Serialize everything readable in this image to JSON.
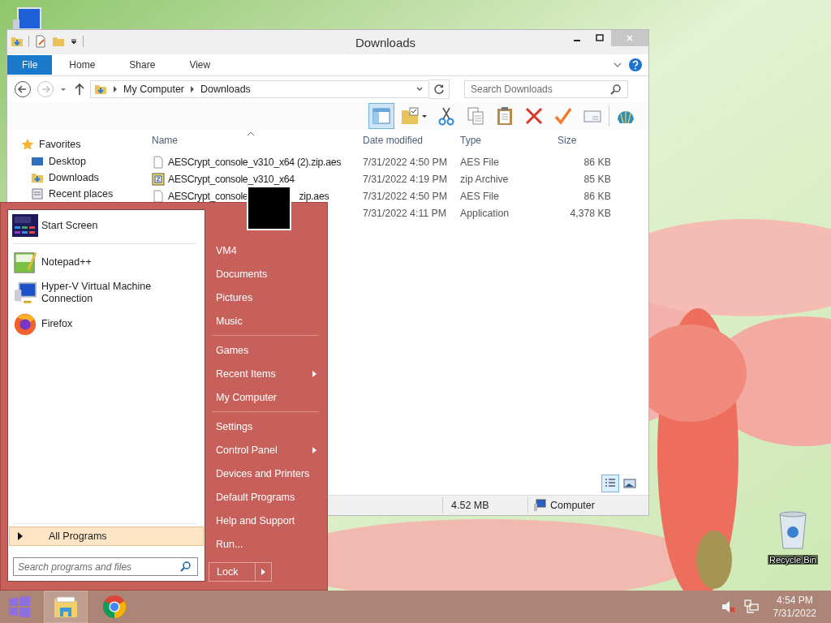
{
  "desktop": {
    "icons": [
      {
        "label": "Recycle Bin",
        "kind": "recycle-bin"
      }
    ]
  },
  "explorer": {
    "title": "Downloads",
    "ribbon_tabs": [
      {
        "label": "File",
        "selected": true
      },
      {
        "label": "Home",
        "selected": false
      },
      {
        "label": "Share",
        "selected": false
      },
      {
        "label": "View",
        "selected": false
      }
    ],
    "navigation": {
      "back": {
        "disabled": false
      },
      "forward": {
        "disabled": true
      }
    },
    "address": {
      "path": [
        "My Computer",
        "Downloads"
      ]
    },
    "search": {
      "placeholder": "Search Downloads"
    },
    "toolbar": [
      {
        "kind": "pane",
        "selected": true
      },
      {
        "kind": "folder-options",
        "selected": false
      },
      {
        "kind": "cut",
        "selected": false
      },
      {
        "kind": "copy",
        "selected": false
      },
      {
        "kind": "paste",
        "selected": false
      },
      {
        "kind": "delete",
        "selected": false
      },
      {
        "kind": "properties",
        "selected": false
      },
      {
        "kind": "email",
        "selected": false
      },
      {
        "kind": "shell",
        "selected": false
      }
    ],
    "sidebar": {
      "items": [
        {
          "label": "Favorites",
          "kind": "favorites"
        },
        {
          "label": "Desktop",
          "kind": "desktop"
        },
        {
          "label": "Downloads",
          "kind": "downloads"
        },
        {
          "label": "Recent places",
          "kind": "recent"
        }
      ]
    },
    "table": {
      "columns": [
        "Name",
        "Date modified",
        "Type",
        "Size"
      ],
      "rows": [
        {
          "kind": "file",
          "name": "AESCrypt_console_v310_x64 (2).zip.aes",
          "date": "7/31/2022 4:50 PM",
          "type": "AES File",
          "size": "86 KB"
        },
        {
          "kind": "zip",
          "name": "AESCrypt_console_v310_x64",
          "date": "7/31/2022 4:19 PM",
          "type": "zip Archive",
          "size": "85 KB"
        },
        {
          "kind": "file",
          "name": "AESCrypt_console",
          "name_tail": "zip.aes",
          "date": "7/31/2022 4:50 PM",
          "type": "AES File",
          "size": "86 KB"
        },
        {
          "date": "7/31/2022 4:11 PM",
          "type": "Application",
          "size": "4,378 KB"
        }
      ]
    },
    "view_buttons": [
      {
        "kind": "details",
        "selected": true
      },
      {
        "kind": "large-icons",
        "selected": false
      }
    ],
    "status_bar": {
      "size": "4.52 MB",
      "location": "Computer"
    }
  },
  "start_menu": {
    "pinned": [
      {
        "label": "Start Screen",
        "kind": "start-screen"
      }
    ],
    "programs": [
      {
        "label": "Notepad++",
        "kind": "notepad"
      },
      {
        "label": "Hyper-V Virtual Machine Connection",
        "kind": "hyperv"
      },
      {
        "label": "Firefox",
        "kind": "firefox"
      }
    ],
    "all_programs": {
      "label": "All Programs",
      "selected": true
    },
    "search": {
      "placeholder": "Search programs and files"
    },
    "place_groups": [
      {
        "items": [
          {
            "label": "VM4",
            "submenu": false
          },
          {
            "label": "Documents",
            "submenu": false
          },
          {
            "label": "Pictures",
            "submenu": false
          },
          {
            "label": "Music",
            "submenu": false
          }
        ]
      },
      {
        "items": [
          {
            "label": "Games",
            "submenu": false
          },
          {
            "label": "Recent Items",
            "submenu": true
          },
          {
            "label": "My Computer",
            "submenu": false
          }
        ]
      },
      {
        "items": [
          {
            "label": "Settings",
            "submenu": false
          },
          {
            "label": "Control Panel",
            "submenu": true
          },
          {
            "label": "Devices and Printers",
            "submenu": false
          },
          {
            "label": "Default Programs",
            "submenu": false
          },
          {
            "label": "Help and Support",
            "submenu": false
          },
          {
            "label": "Run...",
            "submenu": false
          }
        ]
      }
    ],
    "power_button": {
      "label": "Lock"
    }
  },
  "taskbar": {
    "apps": [
      {
        "kind": "explorer",
        "selected": true
      },
      {
        "kind": "chrome",
        "selected": false
      }
    ],
    "volume": {
      "muted": true
    },
    "clock": {
      "time": "4:54 PM",
      "date": "7/31/2022"
    }
  }
}
